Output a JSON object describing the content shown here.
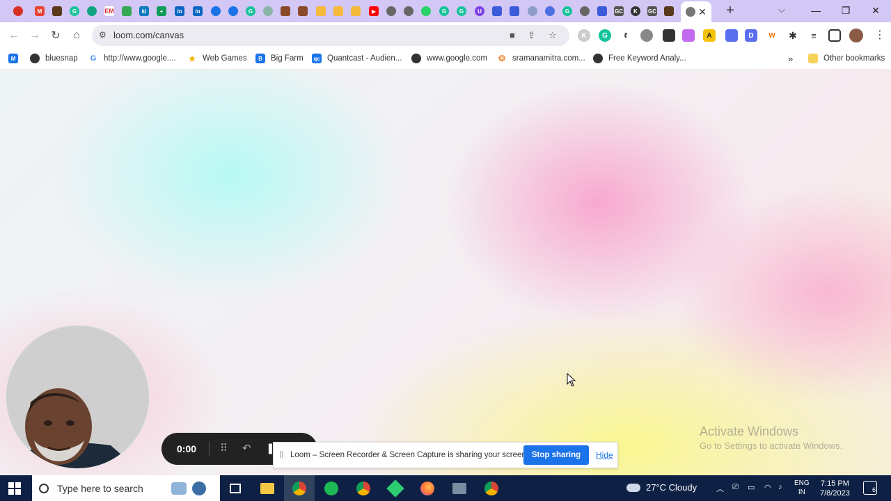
{
  "browser": {
    "url": "loom.com/canvas",
    "bookmarks": [
      {
        "label": "",
        "icon": "gmail-icon",
        "color": "#d93025"
      },
      {
        "label": "bluesnap",
        "icon": "globe-icon",
        "color": "#333333"
      },
      {
        "label": "http://www.google....",
        "icon": "google-icon",
        "color": "#4285f4"
      },
      {
        "label": "Web Games",
        "icon": "star-icon",
        "color": "#f4b400"
      },
      {
        "label": "Big Farm",
        "icon": "bigfarm-icon",
        "color": "#1a73e8"
      },
      {
        "label": "Quantcast - Audien...",
        "icon": "quantcast-icon",
        "color": "#1a73e8"
      },
      {
        "label": "www.google.com",
        "icon": "globe-icon",
        "color": "#333333"
      },
      {
        "label": "sramanamitra.com...",
        "icon": "swirl-icon",
        "color": "#e8710a"
      },
      {
        "label": "Free Keyword Analy...",
        "icon": "globe-icon",
        "color": "#333333"
      }
    ],
    "other_bookmarks": "Other bookmarks"
  },
  "loom": {
    "timer": "0:00",
    "share_message": "Loom – Screen Recorder & Screen Capture is sharing your screen.",
    "stop_label": "Stop sharing",
    "hide_label": "Hide"
  },
  "watermark": {
    "title": "Activate Windows",
    "subtitle": "Go to Settings to activate Windows."
  },
  "taskbar": {
    "search_placeholder": "Type here to search",
    "weather": "27°C  Cloudy",
    "lang_top": "ENG",
    "lang_bottom": "IN",
    "time": "7:15 PM",
    "date": "7/8/2023",
    "notifications": "6"
  }
}
